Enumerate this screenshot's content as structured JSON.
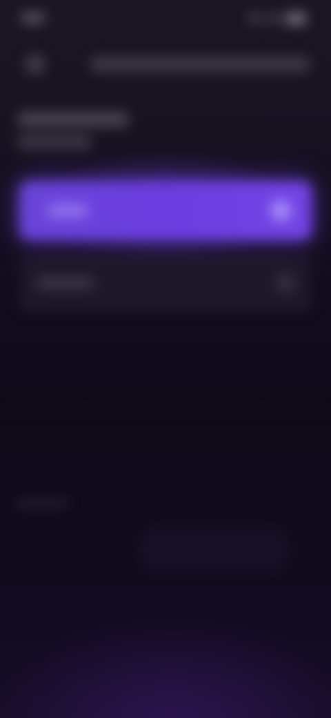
{
  "theme": {
    "background": "#0d0814",
    "accent": "#6c3de0",
    "blurred": true
  },
  "status_bar": {
    "icons": [
      "signal-icon",
      "wifi-icon",
      "battery-icon"
    ]
  },
  "header": {
    "icons": [
      "back-icon"
    ]
  },
  "primary_action": {
    "trailing_icon": "chevron-right-icon"
  },
  "secondary_action": {
    "trailing_icon": "chevron-right-icon"
  }
}
